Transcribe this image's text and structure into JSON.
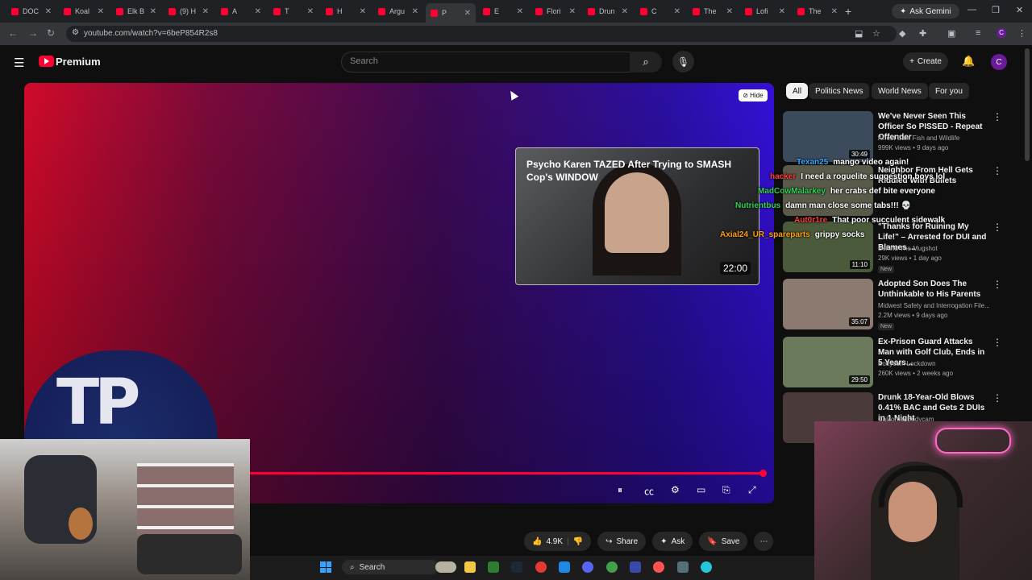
{
  "browser": {
    "tabs": [
      {
        "label": "DOC"
      },
      {
        "label": "Koal"
      },
      {
        "label": "Elk B"
      },
      {
        "label": "(9) H"
      },
      {
        "label": "A"
      },
      {
        "label": "T"
      },
      {
        "label": "H"
      },
      {
        "label": "Argu"
      },
      {
        "label": "P",
        "active": true
      },
      {
        "label": "E"
      },
      {
        "label": "Flori"
      },
      {
        "label": "Drun"
      },
      {
        "label": "C"
      },
      {
        "label": "The"
      },
      {
        "label": "Lofi"
      },
      {
        "label": "The"
      }
    ],
    "new_tab_label": "+",
    "ask_gemini_label": "Ask Gemini",
    "url": "youtube.com/watch?v=6beP854R2s8"
  },
  "youtube": {
    "brand": "Premium",
    "search_placeholder": "Search",
    "create_label": "Create",
    "avatar_letter": "C"
  },
  "player": {
    "hide_label": "Hide",
    "endcard_title": "Psycho Karen TAZED After Trying to SMASH Cop's WINDOW",
    "endcard_duration": "22:00",
    "logo_text": "TP",
    "progress_fraction": 1.0
  },
  "actions": {
    "like_count": "4.9K",
    "share_label": "Share",
    "ask_label": "Ask",
    "save_label": "Save"
  },
  "chips": [
    {
      "label": "All",
      "selected": true
    },
    {
      "label": "Politics News"
    },
    {
      "label": "World News"
    },
    {
      "label": "For you"
    }
  ],
  "sidebar_videos": [
    {
      "title": "We've Never Seen This Officer So PISSED - Repeat Offender",
      "channel": "Arrest Cam Fish and Wildlife",
      "meta": "999K views • 9 days ago",
      "duration": "30:49"
    },
    {
      "title": "Neighbor From Hell Gets Riddled With Bullets",
      "channel": "",
      "meta": "",
      "duration": ""
    },
    {
      "title": "\"Thanks for Ruining My Life!\" – Arrested for DUI and Blames ...",
      "channel": "Behind The Mugshot",
      "meta": "29K views • 1 day ago",
      "duration": "11:10",
      "badge": "New"
    },
    {
      "title": "Adopted Son Does The Unthinkable to His Parents",
      "channel": "Midwest Safety and Interrogation File...",
      "meta": "2.2M views • 9 days ago",
      "duration": "35:07",
      "badge": "New"
    },
    {
      "title": "Ex-Prison Guard Attacks Man with Golf Club, Ends in 5 Years...",
      "channel": "Bodycam Lockdown",
      "meta": "260K views • 2 weeks ago",
      "duration": "29:50"
    },
    {
      "title": "Drunk 18-Year-Old Blows 0.41% BAC and Gets 2 DUIs in 1 Night",
      "channel": "California Bodycam",
      "meta": "",
      "duration": ""
    }
  ],
  "chat": [
    {
      "user": "Texan25",
      "msg": "mango video again!",
      "color": "#3ea6ff"
    },
    {
      "user": "hacker",
      "msg": "I need a roguelite suggestion boys lol",
      "color": "#ff3b3b"
    },
    {
      "user": "MadCowMalarkey",
      "msg": "her crabs def bite everyone",
      "color": "#30d158"
    },
    {
      "user": "Nutrientbus",
      "msg": "damn man close some tabs!!! 💀",
      "color": "#30d158"
    },
    {
      "user": "Aut0r1re",
      "msg": "That poor succulent sidewalk",
      "color": "#ff3b3b"
    },
    {
      "user": "Axial24_UR_spareparts",
      "msg": "grippy socks",
      "color": "#ff9f0a"
    }
  ],
  "taskbar": {
    "search_label": "Search"
  },
  "colors": {
    "brand_red": "#ff0033",
    "background": "#0f0f0f"
  }
}
